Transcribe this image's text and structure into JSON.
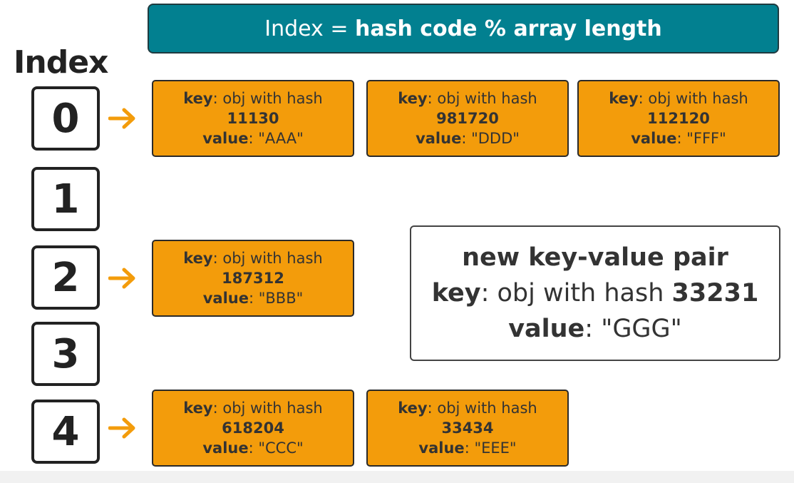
{
  "formula": {
    "prefix": "Index = ",
    "expression": "hash code % array length"
  },
  "index_heading": "Index",
  "indices": [
    "0",
    "1",
    "2",
    "3",
    "4"
  ],
  "buckets": [
    {
      "index": "0",
      "entries": [
        {
          "key_label": "key",
          "key_text": ": obj with hash",
          "hash": "11130",
          "value_label": "value",
          "value_text": ": \"AAA\""
        },
        {
          "key_label": "key",
          "key_text": ": obj with hash",
          "hash": "981720",
          "value_label": "value",
          "value_text": ": \"DDD\""
        },
        {
          "key_label": "key",
          "key_text": ": obj with hash",
          "hash": "112120",
          "value_label": "value",
          "value_text": ": \"FFF\""
        }
      ]
    },
    {
      "index": "2",
      "entries": [
        {
          "key_label": "key",
          "key_text": ": obj with hash",
          "hash": "187312",
          "value_label": "value",
          "value_text": ": \"BBB\""
        }
      ]
    },
    {
      "index": "4",
      "entries": [
        {
          "key_label": "key",
          "key_text": ": obj with hash",
          "hash": "618204",
          "value_label": "value",
          "value_text": ": \"CCC\""
        },
        {
          "key_label": "key",
          "key_text": ": obj with hash",
          "hash": "33434",
          "value_label": "value",
          "value_text": ": \"EEE\""
        }
      ]
    }
  ],
  "new_pair": {
    "title": "new key-value pair",
    "key_label": "key",
    "key_text": ": obj with hash ",
    "hash": "33231",
    "value_label": "value",
    "value_text": ": \"GGG\""
  },
  "colors": {
    "banner": "#028090",
    "entry": "#f39c0b",
    "arrow": "#f39c0b",
    "ink": "#222222"
  },
  "icons": {
    "bucket_pointer": "arrow-right-icon"
  }
}
